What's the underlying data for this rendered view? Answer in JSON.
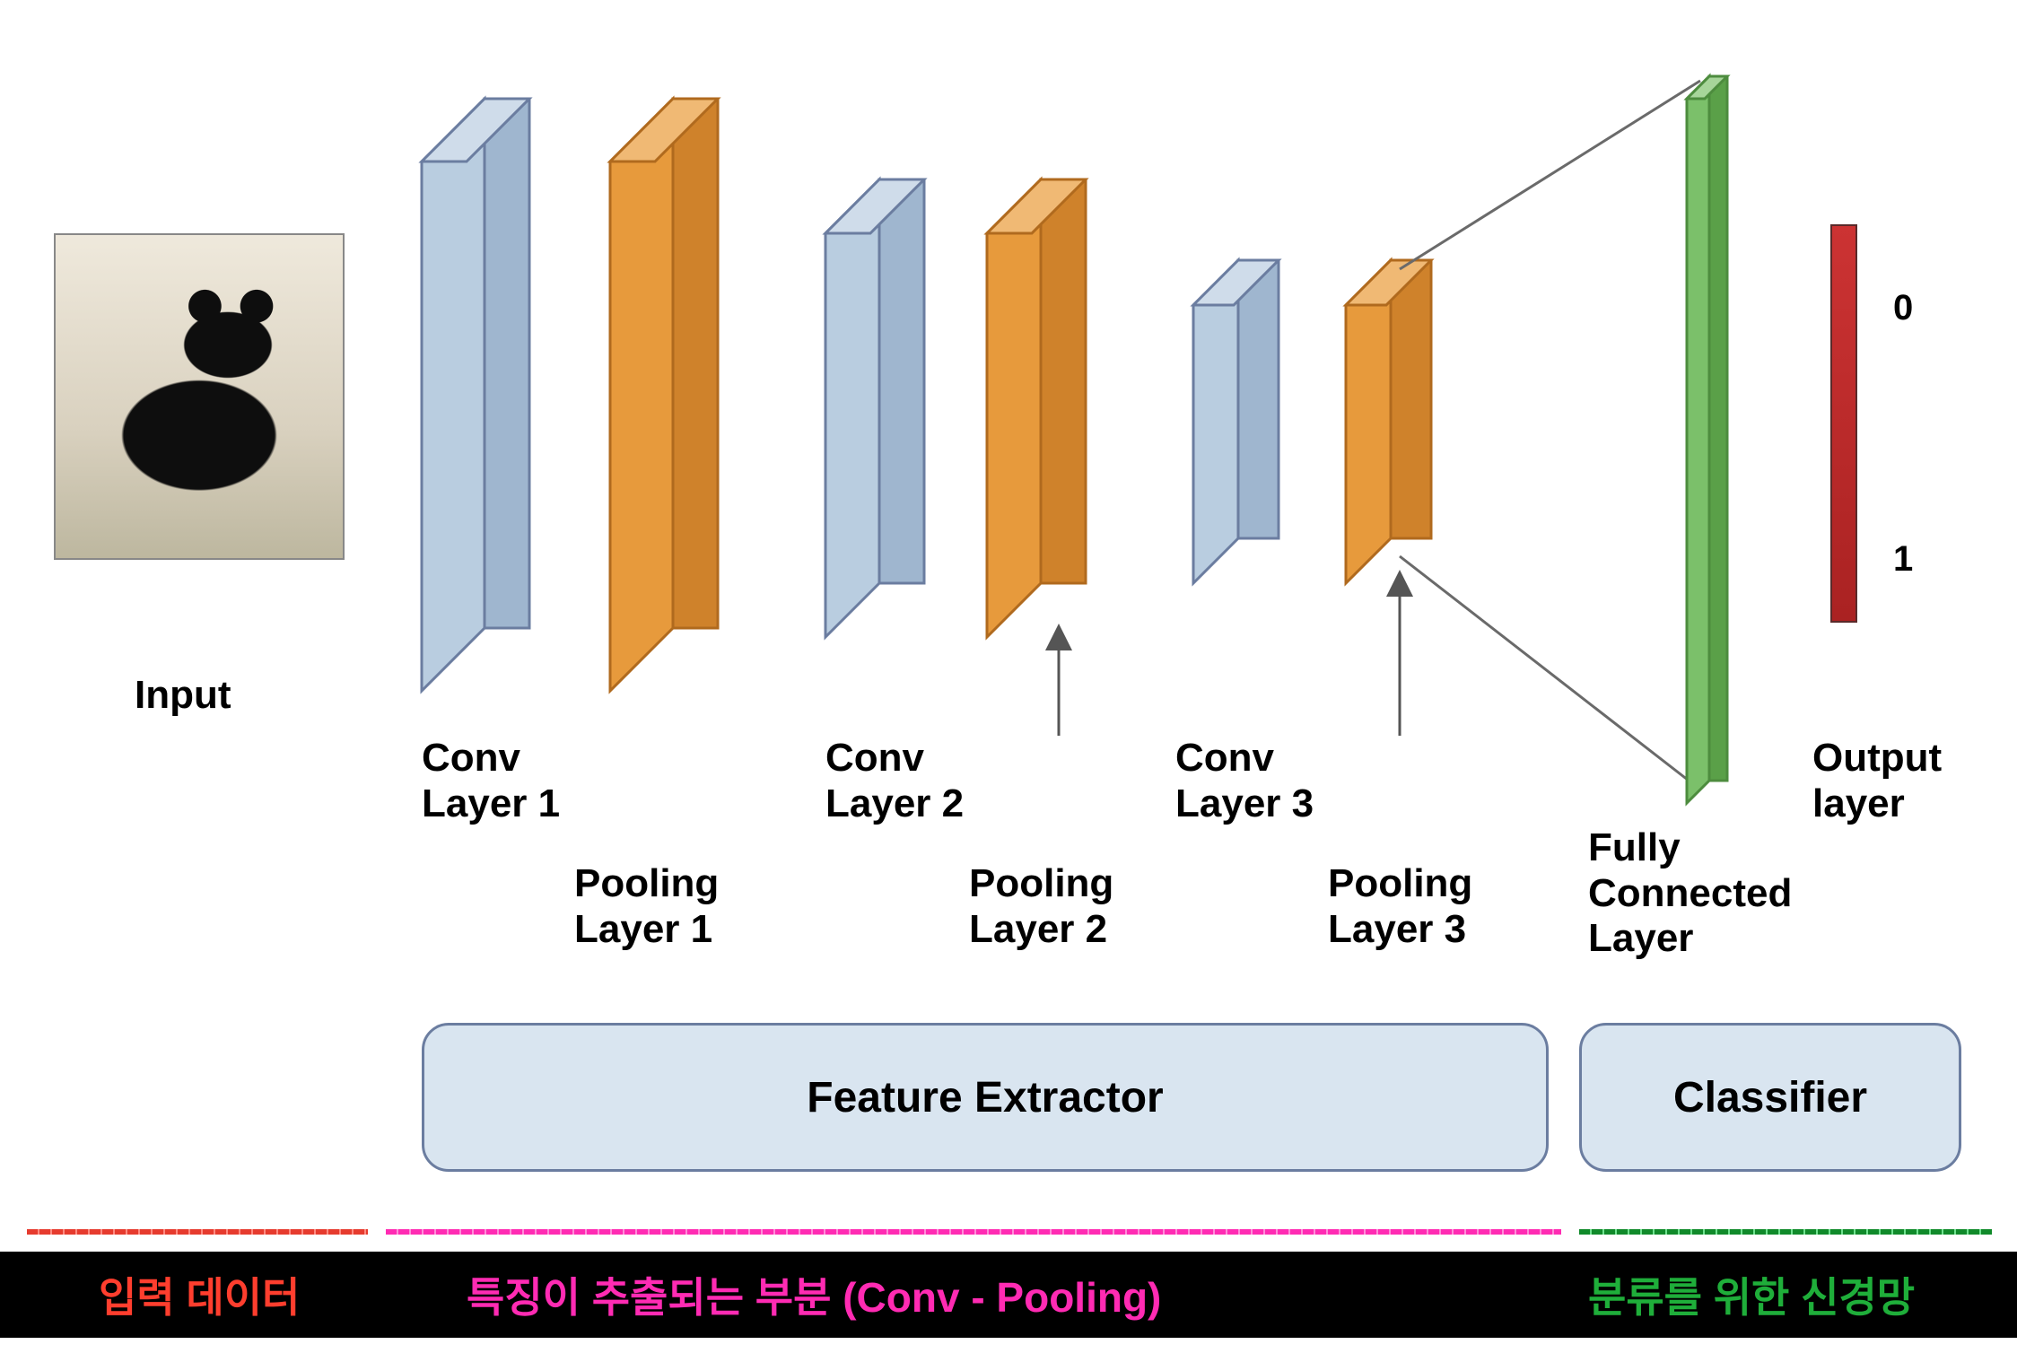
{
  "labels": {
    "input": "Input",
    "conv1": "Conv\nLayer 1",
    "pool1": "Pooling\nLayer 1",
    "conv2": "Conv\nLayer 2",
    "pool2": "Pooling\nLayer 2",
    "conv3": "Conv\nLayer 3",
    "pool3": "Pooling\nLayer 3",
    "fc": "Fully\nConnected\nLayer",
    "out": "Output\nlayer",
    "zero": "0",
    "one": "1"
  },
  "boxes": {
    "feature": "Feature Extractor",
    "classifier": "Classifier"
  },
  "footer": {
    "left": "입력 데이터",
    "mid": "특징이 추출되는 부분 (Conv - Pooling)",
    "right": "분류를 위한 신경망"
  },
  "colors": {
    "conv": {
      "light": "#cfdcea",
      "mid": "#b9cde0",
      "dark": "#9fb6cf"
    },
    "pool": {
      "light": "#f0b974",
      "mid": "#e79a3c",
      "dark": "#cf822b"
    },
    "fc": {
      "light": "#a7d59a",
      "mid": "#7bc06a",
      "dark": "#5aa048"
    },
    "footer": {
      "left": "#ff3e2e",
      "mid": "#ff2bb3",
      "right": "#1fae3a"
    }
  }
}
